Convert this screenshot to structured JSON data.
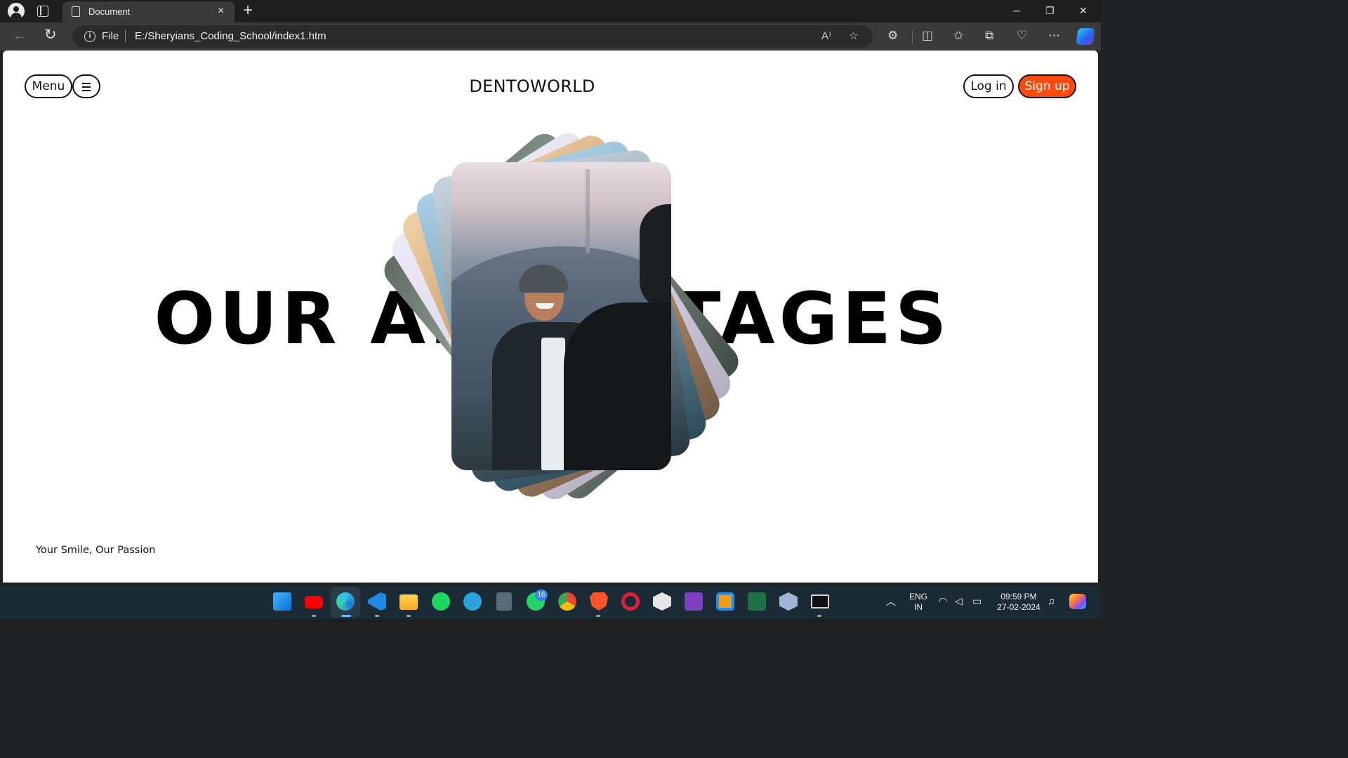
{
  "browser": {
    "tab_title": "Document",
    "address_scheme": "File",
    "address_url": "E:/Sheryians_Coding_School/index1.htm",
    "close_glyph": "×",
    "new_tab_glyph": "+",
    "minimize_glyph": "─",
    "restore_glyph": "❐",
    "window_close_glyph": "✕"
  },
  "page": {
    "brand": "DENTOWORLD",
    "menu_label": "Menu",
    "login_label": "Log in",
    "signup_label": "Sign up",
    "hero_heading": "OUR ADVANTAGES",
    "tagline": "Your Smile, Our Passion",
    "signup_color": "#ff4a0e"
  },
  "taskbar": {
    "whatsapp_badge": "16",
    "lang": "ENG",
    "region": "IN",
    "time": "09:59 PM",
    "date": "27-02-2024",
    "apps": [
      "start",
      "youtube",
      "edge",
      "vscode",
      "file-explorer",
      "spotify",
      "telegram",
      "calculator",
      "whatsapp",
      "chrome",
      "brave",
      "opera",
      "unity",
      "onenote",
      "virtualbox",
      "excel",
      "3d-viewer",
      "terminal"
    ]
  }
}
